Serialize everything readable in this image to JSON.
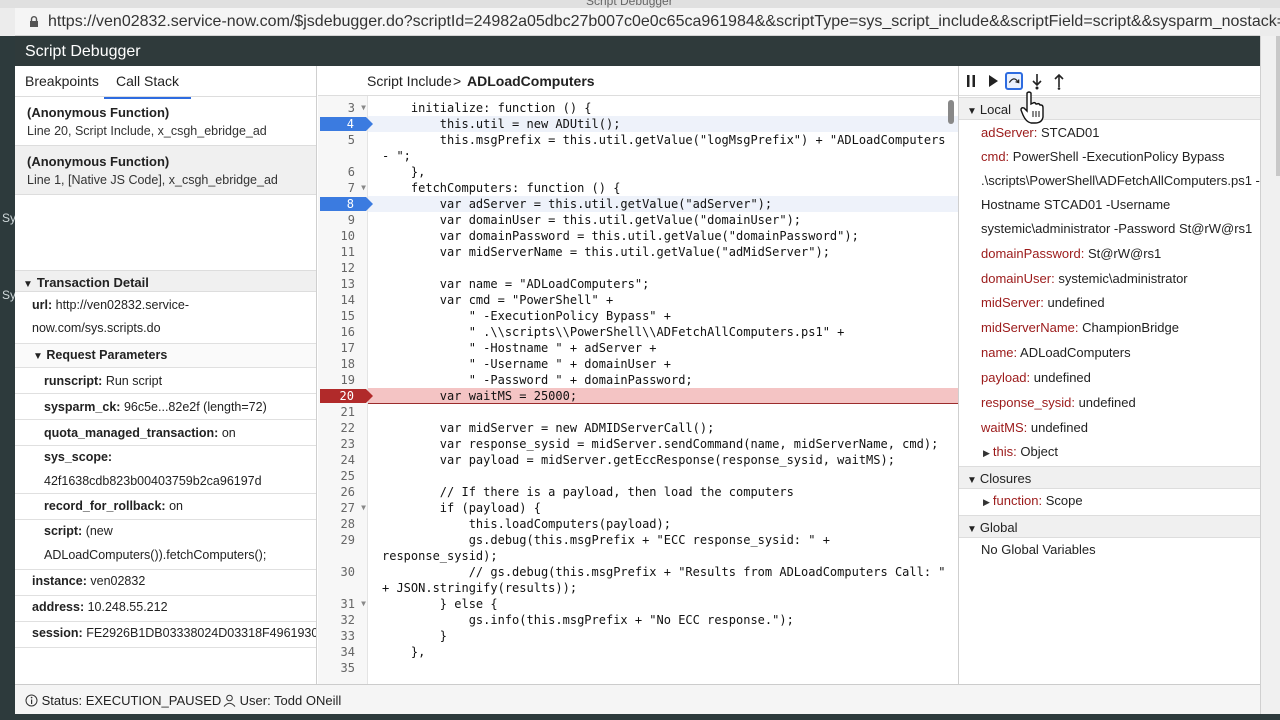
{
  "browser": {
    "window_title": "Script Debugger",
    "url": "https://ven02832.service-now.com/$jsdebugger.do?scriptId=24982a05dbc27b007c0e0c65ca961984&&scriptType=sys_script_include&&scriptField=script&&sysparm_nostack=..."
  },
  "window": {
    "title": "Script Debugger"
  },
  "left": {
    "tabs": [
      "Breakpoints",
      "Call Stack"
    ],
    "active_tab": "Call Stack",
    "call_stack": [
      {
        "fn": "(Anonymous Function)",
        "loc": "Line 20, Script Include, x_csgh_ebridge_ad"
      },
      {
        "fn": "(Anonymous Function)",
        "loc": "Line 1, [Native JS Code], x_csgh_ebridge_ad"
      }
    ],
    "transaction_title": "Transaction Detail",
    "url_key": "url:",
    "url_val1": "http://ven02832.service-",
    "url_val2": "now.com/sys.scripts.do",
    "req_params_title": "Request Parameters",
    "params": [
      {
        "k": "runscript:",
        "v": "Run script"
      },
      {
        "k": "sysparm_ck:",
        "v": "96c5e...82e2f (length=72)"
      },
      {
        "k": "quota_managed_transaction:",
        "v": "on"
      },
      {
        "k": "sys_scope:",
        "v": "42f1638cdb823b00403759b2ca96197d"
      },
      {
        "k": "record_for_rollback:",
        "v": "on"
      },
      {
        "k": "script:",
        "v": "(new",
        "v2": "ADLoadComputers()).fetchComputers();"
      }
    ],
    "instance": {
      "k": "instance:",
      "v": "ven02832"
    },
    "address": {
      "k": "address:",
      "v": "10.248.55.212"
    },
    "session": {
      "k": "session:",
      "v": "FE2926B1DB03338024D03318F4961930"
    }
  },
  "middle": {
    "crumb_a": "Script Include",
    "crumb_sep": ">",
    "crumb_b": "ADLoadComputers",
    "lines": [
      {
        "n": "3",
        "fold": true,
        "t": "    initialize: function () {"
      },
      {
        "n": "4",
        "bp": true,
        "t": "        this.util = new ADUtil();"
      },
      {
        "n": "5",
        "t": "        this.msgPrefix = this.util.getValue(\"logMsgPrefix\") + \"ADLoadComputers"
      },
      {
        "n": "",
        "t": "- \";",
        "wrap": true
      },
      {
        "n": "6",
        "t": "    },"
      },
      {
        "n": "7",
        "fold": true,
        "t": "    fetchComputers: function () {"
      },
      {
        "n": "8",
        "bp": true,
        "t": "        var adServer = this.util.getValue(\"adServer\");"
      },
      {
        "n": "9",
        "t": "        var domainUser = this.util.getValue(\"domainUser\");"
      },
      {
        "n": "10",
        "t": "        var domainPassword = this.util.getValue(\"domainPassword\");"
      },
      {
        "n": "11",
        "t": "        var midServerName = this.util.getValue(\"adMidServer\");"
      },
      {
        "n": "12",
        "t": ""
      },
      {
        "n": "13",
        "t": "        var name = \"ADLoadComputers\";"
      },
      {
        "n": "14",
        "t": "        var cmd = \"PowerShell\" +"
      },
      {
        "n": "15",
        "t": "            \" -ExecutionPolicy Bypass\" +"
      },
      {
        "n": "16",
        "t": "            \" .\\\\scripts\\\\PowerShell\\\\ADFetchAllComputers.ps1\" +"
      },
      {
        "n": "17",
        "t": "            \" -Hostname \" + adServer +"
      },
      {
        "n": "18",
        "t": "            \" -Username \" + domainUser +"
      },
      {
        "n": "19",
        "t": "            \" -Password \" + domainPassword;"
      },
      {
        "n": "20",
        "bp": true,
        "current": true,
        "t": "        var waitMS = 25000;"
      },
      {
        "n": "21",
        "t": ""
      },
      {
        "n": "22",
        "t": "        var midServer = new ADMIDServerCall();"
      },
      {
        "n": "23",
        "t": "        var response_sysid = midServer.sendCommand(name, midServerName, cmd);"
      },
      {
        "n": "24",
        "t": "        var payload = midServer.getEccResponse(response_sysid, waitMS);"
      },
      {
        "n": "25",
        "t": ""
      },
      {
        "n": "26",
        "t": "        // If there is a payload, then load the computers"
      },
      {
        "n": "27",
        "fold": true,
        "t": "        if (payload) {"
      },
      {
        "n": "28",
        "t": "            this.loadComputers(payload);"
      },
      {
        "n": "29",
        "t": "            gs.debug(this.msgPrefix + \"ECC response_sysid: \" +"
      },
      {
        "n": "",
        "t": "response_sysid);",
        "wrap": true
      },
      {
        "n": "30",
        "t": "            // gs.debug(this.msgPrefix + \"Results from ADLoadComputers Call: \""
      },
      {
        "n": "",
        "t": "+ JSON.stringify(results));",
        "wrap": true
      },
      {
        "n": "31",
        "fold": true,
        "t": "        } else {"
      },
      {
        "n": "32",
        "t": "            gs.info(this.msgPrefix + \"No ECC response.\");"
      },
      {
        "n": "33",
        "t": "        }"
      },
      {
        "n": "34",
        "t": "    },"
      },
      {
        "n": "35",
        "t": ""
      }
    ]
  },
  "right": {
    "controls": [
      "pause-icon",
      "resume-icon",
      "step-over-icon",
      "step-into-icon",
      "step-out-icon"
    ],
    "local_title": "Local",
    "locals": [
      {
        "k": "adServer:",
        "v": "STCAD01"
      },
      {
        "k": "cmd:",
        "v": "PowerShell -ExecutionPolicy Bypass"
      },
      {
        "k": "",
        "v": ".\\scripts\\PowerShell\\ADFetchAllComputers.ps1 -"
      },
      {
        "k": "",
        "v": "Hostname STCAD01 -Username"
      },
      {
        "k": "",
        "v": "systemic\\administrator -Password St@rW@rs1"
      },
      {
        "k": "domainPassword:",
        "v": "St@rW@rs1"
      },
      {
        "k": "domainUser:",
        "v": "systemic\\administrator"
      },
      {
        "k": "midServer:",
        "v": "undefined"
      },
      {
        "k": "midServerName:",
        "v": "ChampionBridge"
      },
      {
        "k": "name:",
        "v": "ADLoadComputers"
      },
      {
        "k": "payload:",
        "v": "undefined"
      },
      {
        "k": "response_sysid:",
        "v": "undefined"
      },
      {
        "k": "waitMS:",
        "v": "undefined"
      },
      {
        "k": "this:",
        "v": "Object",
        "expand": true
      }
    ],
    "closures_title": "Closures",
    "closure": {
      "k": "function:",
      "v": "Scope"
    },
    "global_title": "Global",
    "global_text": "No Global Variables"
  },
  "status": {
    "status_text": "Status: EXECUTION_PAUSED",
    "user_text": "User: Todd ONeill"
  },
  "colors": {
    "breakpoint": "#3b7be0",
    "current_line": "#b12a2a",
    "accent": "#2e6ce0"
  }
}
